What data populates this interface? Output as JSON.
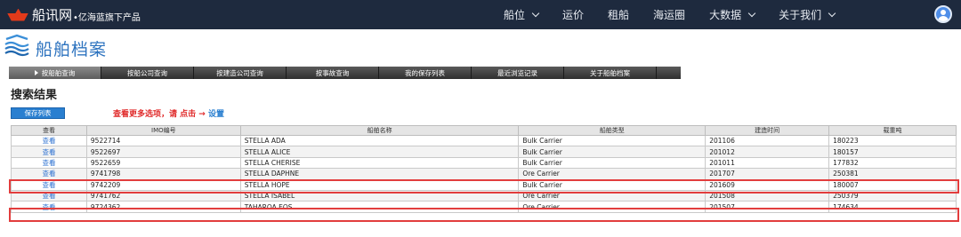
{
  "topbar": {
    "brand": "船讯网",
    "brand_sub": "•亿海蓝旗下产品",
    "nav": [
      {
        "label": "船位",
        "dropdown": true
      },
      {
        "label": "运价",
        "dropdown": false
      },
      {
        "label": "租船",
        "dropdown": false
      },
      {
        "label": "海运圈",
        "dropdown": false
      },
      {
        "label": "大数据",
        "dropdown": true
      },
      {
        "label": "关于我们",
        "dropdown": true
      }
    ]
  },
  "page": {
    "title": "船舶档案"
  },
  "tabs": [
    "按船舶查询",
    "按船公司查询",
    "按建造公司查询",
    "按事故查询",
    "我的保存列表",
    "最近浏览记录",
    "关于船舶档案"
  ],
  "results": {
    "title": "搜索结果",
    "save_button": "保存列表",
    "hint_text": "查看更多选项，请 点击",
    "hint_arrow": "→",
    "hint_link": "设置",
    "columns": [
      "查看",
      "IMO编号",
      "船舶名称",
      "船舶类型",
      "建造时间",
      "载重吨"
    ],
    "rows": [
      {
        "view": "查看",
        "imo": "9522714",
        "name": "STELLA ADA",
        "type": "Bulk Carrier",
        "built": "201106",
        "dwt": "180223"
      },
      {
        "view": "查看",
        "imo": "9522697",
        "name": "STELLA ALICE",
        "type": "Bulk Carrier",
        "built": "201012",
        "dwt": "180157"
      },
      {
        "view": "查看",
        "imo": "9522659",
        "name": "STELLA CHERISE",
        "type": "Bulk Carrier",
        "built": "201011",
        "dwt": "177832"
      },
      {
        "view": "查看",
        "imo": "9741798",
        "name": "STELLA DAPHNE",
        "type": "Ore Carrier",
        "built": "201707",
        "dwt": "250381"
      },
      {
        "view": "查看",
        "imo": "9742209",
        "name": "STELLA HOPE",
        "type": "Bulk Carrier",
        "built": "201609",
        "dwt": "180007"
      },
      {
        "view": "查看",
        "imo": "9741762",
        "name": "STELLA ISABEL",
        "type": "Ore Carrier",
        "built": "201508",
        "dwt": "250379"
      },
      {
        "view": "查看",
        "imo": "9724362",
        "name": "TAHAROA EOS",
        "type": "Ore Carrier",
        "built": "201507",
        "dwt": "174634"
      }
    ]
  },
  "colors": {
    "topbar_bg": "#1e2a3e",
    "brand_red": "#e23a1a",
    "title_blue": "#2d73bf",
    "highlight_red": "#e23d3d"
  }
}
